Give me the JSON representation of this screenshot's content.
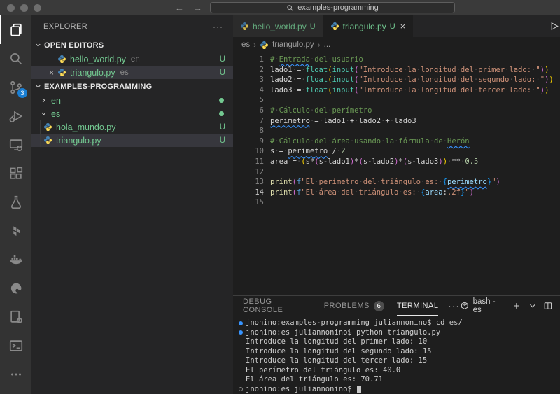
{
  "titlebar": {
    "search_text": "examples-programming"
  },
  "activity_bar": {
    "scm_badge": "3",
    "items": [
      {
        "name": "explorer",
        "active": true
      },
      {
        "name": "search"
      },
      {
        "name": "source-control",
        "badge": "3"
      },
      {
        "name": "run-and-debug"
      },
      {
        "name": "remote-explorer"
      },
      {
        "name": "extensions"
      },
      {
        "name": "testing"
      },
      {
        "name": "terraform"
      },
      {
        "name": "docker"
      },
      {
        "name": "edge-browser"
      },
      {
        "name": "code-runner"
      },
      {
        "name": "terminal"
      },
      {
        "name": "more-views"
      }
    ]
  },
  "sidebar": {
    "title": "EXPLORER",
    "open_editors_label": "OPEN EDITORS",
    "root_label": "EXAMPLES-PROGRAMMING",
    "open_editors": [
      {
        "label": "hello_world.py",
        "detail": "en",
        "badge": "U",
        "selected": false,
        "close": false
      },
      {
        "label": "triangulo.py",
        "detail": "es",
        "badge": "U",
        "selected": true,
        "close": true
      }
    ],
    "tree": [
      {
        "kind": "folder",
        "label": "en",
        "expanded": false,
        "dot": true
      },
      {
        "kind": "folder",
        "label": "es",
        "expanded": true,
        "dot": true
      },
      {
        "kind": "file",
        "label": "hola_mundo.py",
        "badge": "U",
        "selected": false
      },
      {
        "kind": "file",
        "label": "triangulo.py",
        "badge": "U",
        "selected": true
      }
    ]
  },
  "editor": {
    "tabs": [
      {
        "label": "hello_world.py",
        "badge": "U",
        "active": false,
        "closable": false
      },
      {
        "label": "triangulo.py",
        "badge": "U",
        "active": true,
        "closable": true
      }
    ],
    "breadcrumb": [
      "es",
      "triangulo.py",
      "..."
    ],
    "code": {
      "current_line": 14,
      "lines": [
        {
          "n": 1,
          "tokens": [
            {
              "t": "# ",
              "s": "com"
            },
            {
              "t": "Entrada",
              "s": "com",
              "sq": true
            },
            {
              "t": " del usuario",
              "s": "com"
            }
          ]
        },
        {
          "n": 2,
          "tokens": [
            {
              "t": "lado1",
              "s": "v"
            },
            {
              "t": " = ",
              "s": "op"
            },
            {
              "t": "float",
              "s": "cls"
            },
            {
              "t": "(",
              "s": "p1"
            },
            {
              "t": "input",
              "s": "cls"
            },
            {
              "t": "(",
              "s": "p2"
            },
            {
              "t": "\"Introduce la longitud del primer lado: \"",
              "s": "str"
            },
            {
              "t": ")",
              "s": "p2"
            },
            {
              "t": ")",
              "s": "p1"
            }
          ]
        },
        {
          "n": 3,
          "tokens": [
            {
              "t": "lado2",
              "s": "v"
            },
            {
              "t": " = ",
              "s": "op"
            },
            {
              "t": "float",
              "s": "cls"
            },
            {
              "t": "(",
              "s": "p1"
            },
            {
              "t": "input",
              "s": "cls"
            },
            {
              "t": "(",
              "s": "p2"
            },
            {
              "t": "\"Introduce la longitud del segundo lado: \"",
              "s": "str"
            },
            {
              "t": ")",
              "s": "p2"
            },
            {
              "t": ")",
              "s": "p1"
            }
          ]
        },
        {
          "n": 4,
          "tokens": [
            {
              "t": "lado3",
              "s": "v"
            },
            {
              "t": " = ",
              "s": "op"
            },
            {
              "t": "float",
              "s": "cls"
            },
            {
              "t": "(",
              "s": "p1"
            },
            {
              "t": "input",
              "s": "cls"
            },
            {
              "t": "(",
              "s": "p2"
            },
            {
              "t": "\"Introduce la longitud del tercer lado: \"",
              "s": "str"
            },
            {
              "t": ")",
              "s": "p2"
            },
            {
              "t": ")",
              "s": "p1"
            }
          ]
        },
        {
          "n": 5,
          "tokens": []
        },
        {
          "n": 6,
          "tokens": [
            {
              "t": "# Cálculo del perímetro",
              "s": "com"
            }
          ]
        },
        {
          "n": 7,
          "tokens": [
            {
              "t": "perimetro",
              "s": "v",
              "sq": true
            },
            {
              "t": " = ",
              "s": "op"
            },
            {
              "t": "lado1",
              "s": "v"
            },
            {
              "t": " + ",
              "s": "op"
            },
            {
              "t": "lado2",
              "s": "v"
            },
            {
              "t": " + ",
              "s": "op"
            },
            {
              "t": "lado3",
              "s": "v"
            }
          ]
        },
        {
          "n": 8,
          "tokens": []
        },
        {
          "n": 9,
          "tokens": [
            {
              "t": "# Cálculo del área usando la fórmula de ",
              "s": "com"
            },
            {
              "t": "Herón",
              "s": "com",
              "sq": true
            }
          ]
        },
        {
          "n": 10,
          "tokens": [
            {
              "t": "s",
              "s": "v"
            },
            {
              "t": " = ",
              "s": "op"
            },
            {
              "t": "perimetro",
              "s": "v",
              "sq": true
            },
            {
              "t": " / ",
              "s": "op"
            },
            {
              "t": "2",
              "s": "num"
            }
          ]
        },
        {
          "n": 11,
          "tokens": [
            {
              "t": "area",
              "s": "v"
            },
            {
              "t": " = ",
              "s": "op"
            },
            {
              "t": "(",
              "s": "p1"
            },
            {
              "t": "s",
              "s": "v"
            },
            {
              "t": "*",
              "s": "op"
            },
            {
              "t": "(",
              "s": "p2"
            },
            {
              "t": "s",
              "s": "v"
            },
            {
              "t": "-",
              "s": "op"
            },
            {
              "t": "lado1",
              "s": "v"
            },
            {
              "t": ")",
              "s": "p2"
            },
            {
              "t": "*",
              "s": "op"
            },
            {
              "t": "(",
              "s": "p2"
            },
            {
              "t": "s",
              "s": "v"
            },
            {
              "t": "-",
              "s": "op"
            },
            {
              "t": "lado2",
              "s": "v"
            },
            {
              "t": ")",
              "s": "p2"
            },
            {
              "t": "*",
              "s": "op"
            },
            {
              "t": "(",
              "s": "p2"
            },
            {
              "t": "s",
              "s": "v"
            },
            {
              "t": "-",
              "s": "op"
            },
            {
              "t": "lado3",
              "s": "v"
            },
            {
              "t": ")",
              "s": "p2"
            },
            {
              "t": ")",
              "s": "p1"
            },
            {
              "t": " ** ",
              "s": "op"
            },
            {
              "t": "0.5",
              "s": "num"
            }
          ]
        },
        {
          "n": 12,
          "tokens": []
        },
        {
          "n": 13,
          "tokens": [
            {
              "t": "print",
              "s": "fn"
            },
            {
              "t": "(",
              "s": "p2"
            },
            {
              "t": "f",
              "s": "kw"
            },
            {
              "t": "\"El perímetro del triángulo es: ",
              "s": "str"
            },
            {
              "t": "{",
              "s": "br"
            },
            {
              "t": "perimetro",
              "s": "vb",
              "sq": true
            },
            {
              "t": "}",
              "s": "br"
            },
            {
              "t": "\"",
              "s": "str"
            },
            {
              "t": ")",
              "s": "p2"
            }
          ]
        },
        {
          "n": 14,
          "tokens": [
            {
              "t": "print",
              "s": "fn"
            },
            {
              "t": "(",
              "s": "p2"
            },
            {
              "t": "f",
              "s": "kw"
            },
            {
              "t": "\"El área del triángulo es: ",
              "s": "str"
            },
            {
              "t": "{",
              "s": "br"
            },
            {
              "t": "area",
              "s": "vb"
            },
            {
              "t": ":",
              "s": "op"
            },
            {
              "t": ".2f",
              "s": "str"
            },
            {
              "t": "}",
              "s": "br"
            },
            {
              "t": "\"",
              "s": "str"
            },
            {
              "t": ")",
              "s": "p2"
            }
          ]
        },
        {
          "n": 15,
          "tokens": []
        }
      ]
    }
  },
  "panel": {
    "tabs": [
      {
        "label": "DEBUG CONSOLE",
        "active": false
      },
      {
        "label": "PROBLEMS",
        "badge": "6",
        "active": false
      },
      {
        "label": "TERMINAL",
        "active": true
      }
    ],
    "shell_label": "bash - es",
    "terminal_lines": [
      {
        "deco": "filled",
        "text": "jnonino:examples-programming juliannonino$ cd es/"
      },
      {
        "deco": "filled",
        "text": "jnonino:es juliannonino$ python triangulo.py"
      },
      {
        "deco": null,
        "text": "Introduce la longitud del primer lado: 10"
      },
      {
        "deco": null,
        "text": "Introduce la longitud del segundo lado: 15"
      },
      {
        "deco": null,
        "text": "Introduce la longitud del tercer lado: 15"
      },
      {
        "deco": null,
        "text": "El perímetro del triángulo es: 40.0"
      },
      {
        "deco": null,
        "text": "El área del triángulo es: 70.71"
      },
      {
        "deco": "hollow",
        "text": "jnonino:es juliannonino$ ",
        "cursor": true
      }
    ]
  },
  "colors": {
    "untracked": "#73c991",
    "scm_badge": "#1a7fd4",
    "terminal_decoration": "#3794ff",
    "squiggle": "#3794ff",
    "tokens": {
      "v": "#d4d4d4",
      "vb": "#9cdcfe",
      "op": "#d4d4d4",
      "cls": "#4ec9b0",
      "fn": "#dcdcaa",
      "kw": "#569cd6",
      "str": "#ce9178",
      "com": "#6a9955",
      "num": "#b5cea8",
      "p1": "#ffd700",
      "p2": "#d670d6",
      "br": "#179fff"
    }
  }
}
